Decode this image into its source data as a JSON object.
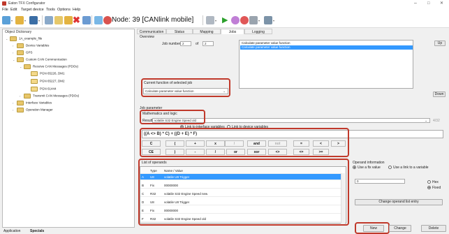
{
  "app": {
    "title": "Eaton TFX Configurator"
  },
  "window_controls": {
    "minimize": "–",
    "maximize": "□",
    "close": "✕"
  },
  "menu": [
    "File",
    "Edit",
    "Target device",
    "Tools",
    "Options",
    "Help"
  ],
  "toolbar": {
    "node_label": "Node: 39 [CANlink mobile]"
  },
  "left_panel": {
    "header": "Object Dictionary",
    "tree": [
      {
        "label": "1A_example_file",
        "level": 0,
        "expanded": true
      },
      {
        "label": "Device Variables",
        "level": 1
      },
      {
        "label": "GPS",
        "level": 1
      },
      {
        "label": "Custom CAN Communication",
        "level": 1,
        "expanded": true
      },
      {
        "label": "Receive CAN Messages (PDOs)",
        "level": 2,
        "expanded": true
      },
      {
        "label": "PGN 65226, DM1",
        "level": 3
      },
      {
        "label": "PGN 65227, DM2",
        "level": 3
      },
      {
        "label": "PGN 61444",
        "level": 3
      },
      {
        "label": "Transmit CAN Messages (PDOs)",
        "level": 2
      },
      {
        "label": "Interface Variables",
        "level": 1
      },
      {
        "label": "Operation Manager",
        "level": 1
      }
    ],
    "bottom_tabs": [
      "Application",
      "Specials"
    ]
  },
  "tabs": [
    "Communication",
    "Status",
    "Mapping",
    "Jobs",
    "Logging"
  ],
  "overview": {
    "label": "Overview",
    "job_number_label": "Job number",
    "job_number_value": "2",
    "of_label": "of",
    "of_value": "2",
    "jobs": [
      "Calculate parameter value function",
      "Calculate parameter value function"
    ],
    "up_button": "Up",
    "down_button": "Down",
    "current_function_label": "Current function of selected job",
    "current_function_value": "Calculate parameter value function"
  },
  "job_parameter": {
    "label": "Job parameter",
    "group": "Mathematics and logic",
    "result_label": "Result:",
    "result_value": "volatile S32 Engine Speed old",
    "result_right": "4/32",
    "radio_interface": "Link to interface variables",
    "radio_device": "Link to device variables",
    "formula": "((A <> B) * C) + ((D + E) * F)",
    "operators_row1": [
      "C",
      "(",
      "+",
      "x",
      "/",
      "and",
      "not",
      "=",
      "<",
      ">"
    ],
    "operators_row2": [
      "CE",
      ")",
      "-",
      "/",
      "or",
      "xor",
      "<>",
      "<=",
      ">="
    ]
  },
  "operands": {
    "label": "List of operands",
    "headers": [
      "",
      "Type",
      "Name / Value"
    ],
    "rows": [
      [
        "A",
        "U8",
        "volatile U8 Trigger"
      ],
      [
        "B",
        "Fix",
        "00000000"
      ],
      [
        "C",
        "R32",
        "volatile S32 Engine Speed new"
      ],
      [
        "D",
        "U8",
        "volatile U8 Trigger"
      ],
      [
        "E",
        "Fix",
        "00000000"
      ],
      [
        "F",
        "R32",
        "volatile S32 Engine Speed old"
      ]
    ]
  },
  "operand_info": {
    "label": "Operand information",
    "radio_fix": "Use a fix value",
    "radio_link": "Use a link to a variable",
    "value": "0",
    "hex_label": "Hex",
    "fixed_label": "Fixed",
    "change_button": "Change operand list entry"
  },
  "bottom_buttons": {
    "new": "New",
    "change": "Change",
    "delete": "Delete"
  }
}
